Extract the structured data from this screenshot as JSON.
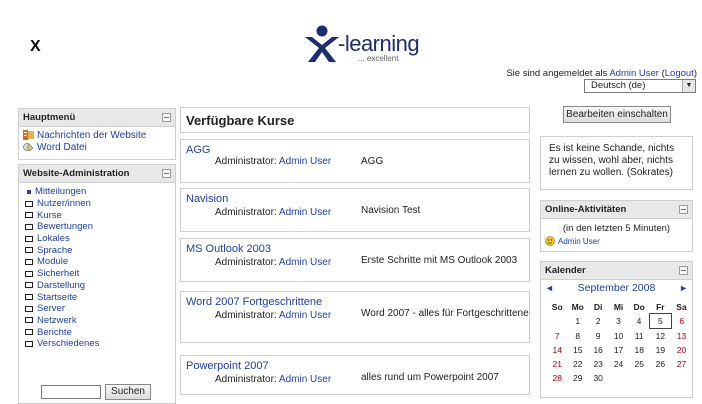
{
  "header": {
    "site_short": "X",
    "logo_text": "-learning",
    "logo_tagline": "... excellent",
    "login_prefix": "Sie sind angemeldet als ",
    "login_user": "Admin User",
    "logout_label": "Logout",
    "language": "Deutsch (de)"
  },
  "main_menu": {
    "title": "Hauptmenü",
    "items": [
      {
        "label": "Nachrichten der Website",
        "icon": "news-icon"
      },
      {
        "label": "Word Datei",
        "icon": "file-icon"
      }
    ]
  },
  "site_admin": {
    "title": "Website-Administration",
    "items": [
      "Mitteilungen",
      "Nutzer/innen",
      "Kurse",
      "Bewertungen",
      "Lokales",
      "Sprache",
      "Module",
      "Sicherheit",
      "Darstellung",
      "Startseite",
      "Server",
      "Netzwerk",
      "Berichte",
      "Verschiedenes"
    ],
    "search_button": "Suchen",
    "search_value": ""
  },
  "courses": {
    "title": "Verfügbare Kurse",
    "teacher_label": "Administrator: ",
    "items": [
      {
        "name": "AGG",
        "teacher": "Admin User",
        "summary": "AGG"
      },
      {
        "name": "Navision",
        "teacher": "Admin User",
        "summary": "Navision Test"
      },
      {
        "name": "MS Outlook 2003",
        "teacher": "Admin User",
        "summary": "Erste Schritte mit MS Outlook 2003"
      },
      {
        "name": "Word 2007 Fortgeschrittene",
        "teacher": "Admin User",
        "summary": "Word 2007 - alles für Fortgeschrittene"
      },
      {
        "name": "Powerpoint 2007",
        "teacher": "Admin User",
        "summary": "alles rund um Powerpoint 2007"
      }
    ]
  },
  "right": {
    "edit_button": "Bearbeiten einschalten",
    "quote": "Es ist keine Schande, nichts zu wissen, wohl aber, nichts lernen zu wollen. (Sokrates)",
    "online": {
      "title": "Online-Aktivitäten",
      "range": "(in den letzten 5 Minuten)",
      "user": "Admin User"
    },
    "calendar": {
      "title": "Kalender",
      "month": "September 2008",
      "prev": "◄",
      "next": "►",
      "weekdays": [
        "So",
        "Mo",
        "Di",
        "Mi",
        "Do",
        "Fr",
        "Sa"
      ],
      "weeks": [
        [
          "",
          "1",
          "2",
          "3",
          "4",
          "5",
          "6"
        ],
        [
          "7",
          "8",
          "9",
          "10",
          "11",
          "12",
          "13"
        ],
        [
          "14",
          "15",
          "16",
          "17",
          "18",
          "19",
          "20"
        ],
        [
          "21",
          "22",
          "23",
          "24",
          "25",
          "26",
          "27"
        ],
        [
          "28",
          "29",
          "30",
          "",
          "",
          "",
          ""
        ]
      ],
      "today": "5"
    }
  },
  "colors": {
    "link": "#1e3fa8",
    "weekend": "#b30000",
    "block_header": "#e8e8e8"
  }
}
